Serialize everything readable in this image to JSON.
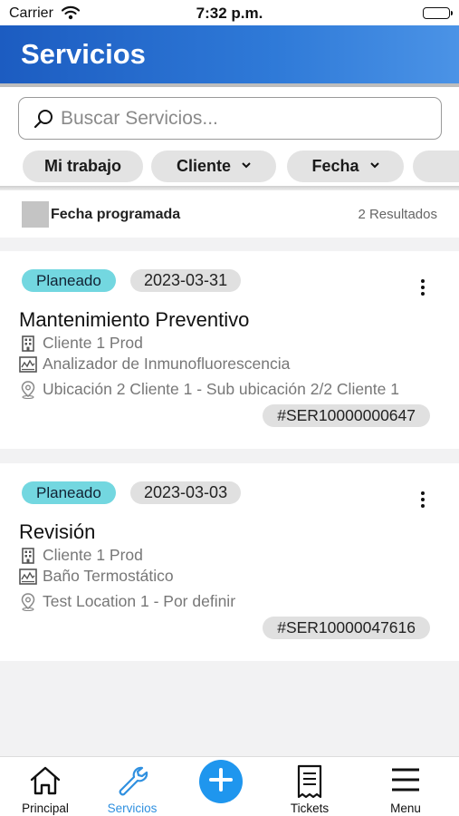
{
  "status_bar": {
    "carrier": "Carrier",
    "time": "7:32 p.m."
  },
  "header": {
    "title": "Servicios"
  },
  "search": {
    "placeholder": "Buscar Servicios..."
  },
  "filters": [
    {
      "label": "Mi trabajo",
      "has_dropdown": false
    },
    {
      "label": "Cliente",
      "has_dropdown": true
    },
    {
      "label": "Fecha",
      "has_dropdown": true
    }
  ],
  "results": {
    "sort_label": "Fecha programada",
    "count": "2 Resultados"
  },
  "services": [
    {
      "status": "Planeado",
      "date": "2023-03-31",
      "title": "Mantenimiento Preventivo",
      "client": "Cliente 1 Prod",
      "equipment": "Analizador de Inmunofluorescencia",
      "location": "Ubicación 2 Cliente 1 - Sub ubicación 2/2 Cliente 1",
      "code": "#SER10000000647"
    },
    {
      "status": "Planeado",
      "date": "2023-03-03",
      "title": "Revisión",
      "client": "Cliente 1 Prod",
      "equipment": "Baño Termostático",
      "location": "Test Location 1 - Por definir",
      "code": "#SER10000047616"
    }
  ],
  "tabbar": [
    {
      "label": "Principal",
      "icon": "home-icon",
      "active": false
    },
    {
      "label": "Servicios",
      "icon": "wrench-icon",
      "active": true
    },
    {
      "label": "Tickets",
      "icon": "receipt-icon",
      "active": false
    },
    {
      "label": "Menu",
      "icon": "hamburger-icon",
      "active": false
    }
  ],
  "colors": {
    "header_start": "#1c5cc1",
    "header_end": "#4b93e6",
    "status_badge": "#73d7e0",
    "accent": "#2f90e0",
    "fab": "#1f96ee"
  }
}
